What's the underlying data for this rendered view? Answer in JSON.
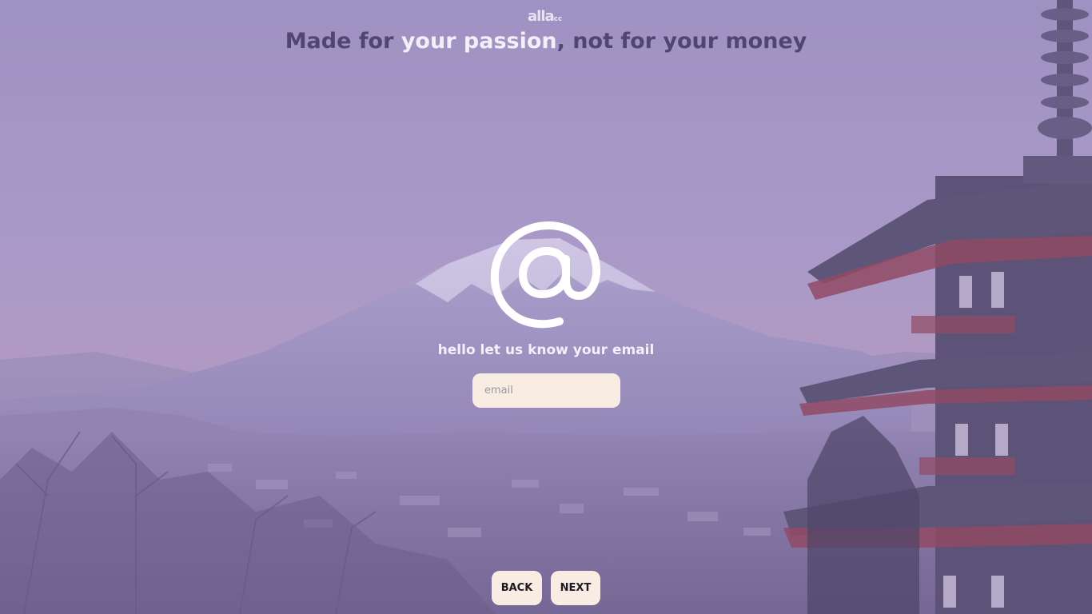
{
  "brand": {
    "logo_main": "alla",
    "logo_suffix": "cc"
  },
  "headline": {
    "part1": "Made for ",
    "highlight1": "your passion",
    "part2": ", not for your money"
  },
  "prompt": {
    "text": "hello let us know your email"
  },
  "email_field": {
    "placeholder": "email",
    "value": ""
  },
  "buttons": {
    "back_label": "BACK",
    "next_label": "NEXT"
  },
  "icons": {
    "at": "at-sign-icon"
  },
  "colors": {
    "overlay": "#a898c6",
    "headline_dark": "#51466f",
    "headline_light": "#f3eff9",
    "field_bg": "#f8ece3"
  }
}
